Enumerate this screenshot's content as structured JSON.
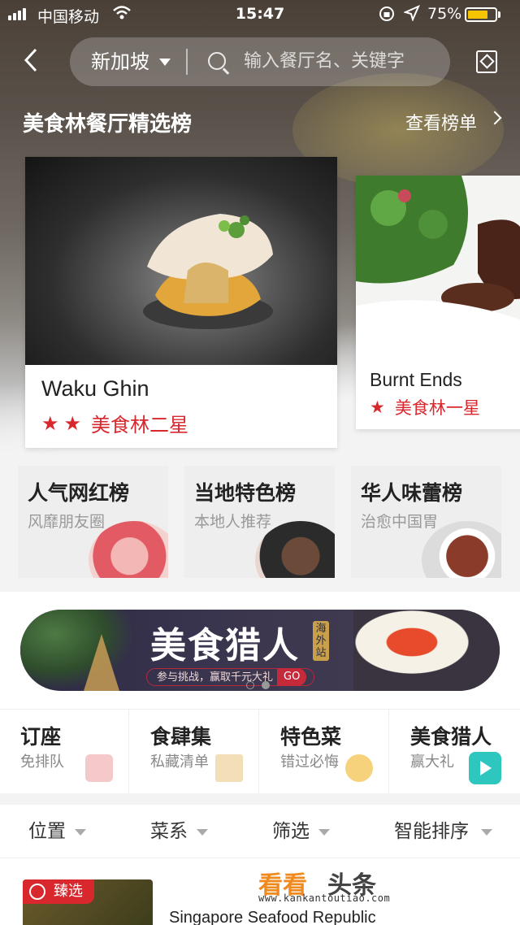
{
  "status_bar": {
    "carrier": "中国移动",
    "time": "15:47",
    "battery": "75%",
    "battery_level": 0.75
  },
  "nav": {
    "city": "新加坡",
    "search_placeholder": "输入餐厅名、关键字"
  },
  "section": {
    "title": "美食林餐厅精选榜",
    "more_label": "查看榜单"
  },
  "restaurants": [
    {
      "name": "Waku Ghin",
      "stars": 2,
      "rating_label": "美食林二星"
    },
    {
      "name": "Burnt Ends",
      "stars": 1,
      "rating_label": "美食林一星"
    }
  ],
  "rank_tiles": [
    {
      "title": "人气网红榜",
      "subtitle": "风靡朋友圈"
    },
    {
      "title": "当地特色榜",
      "subtitle": "本地人推荐"
    },
    {
      "title": "华人味蕾榜",
      "subtitle": "治愈中国胃"
    }
  ],
  "banner": {
    "title": "美食猎人",
    "badge": "海外站",
    "subtitle": "参与挑战，赢取千元大礼",
    "cta": "GO",
    "pages": 2,
    "active_page": 2
  },
  "quick_entries": [
    {
      "title": "订座",
      "subtitle": "免排队",
      "icon": "calendar-icon"
    },
    {
      "title": "食肆集",
      "subtitle": "私藏清单",
      "icon": "clipboard-icon"
    },
    {
      "title": "特色菜",
      "subtitle": "错过必悔",
      "icon": "bowl-icon"
    },
    {
      "title": "美食猎人",
      "subtitle": "赢大礼",
      "icon": "play-icon"
    }
  ],
  "filters": [
    {
      "label": "位置"
    },
    {
      "label": "菜系"
    },
    {
      "label": "筛选"
    },
    {
      "label": "智能排序"
    }
  ],
  "list": {
    "tag": "臻选",
    "first_name": "Singapore Seafood Republic"
  },
  "watermark": {
    "brand_a": "看看",
    "brand_b": "头条",
    "url": "www.kankantoutiao.com"
  },
  "colors": {
    "accent_red": "#d9272e",
    "watermark_orange": "#f08a1e"
  }
}
